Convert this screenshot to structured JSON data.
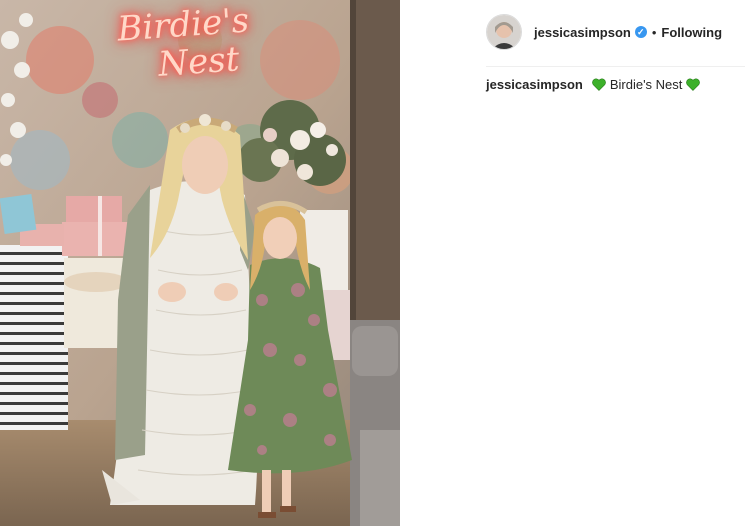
{
  "post": {
    "neon_sign": [
      "Birdie's",
      "Nest"
    ]
  },
  "header": {
    "avatar_icon": "profile-avatar",
    "username": "jessicasimpson",
    "verified_icon": "verified-badge-icon",
    "separator": "•",
    "follow_state": "Following"
  },
  "caption": {
    "username": "jessicasimpson",
    "heart_icon": "green-heart-emoji",
    "text": "Birdie's Nest",
    "heart_color": "#3cb02a"
  },
  "colors": {
    "verified_blue": "#3897f0",
    "text": "#262626",
    "divider": "#efefef"
  }
}
